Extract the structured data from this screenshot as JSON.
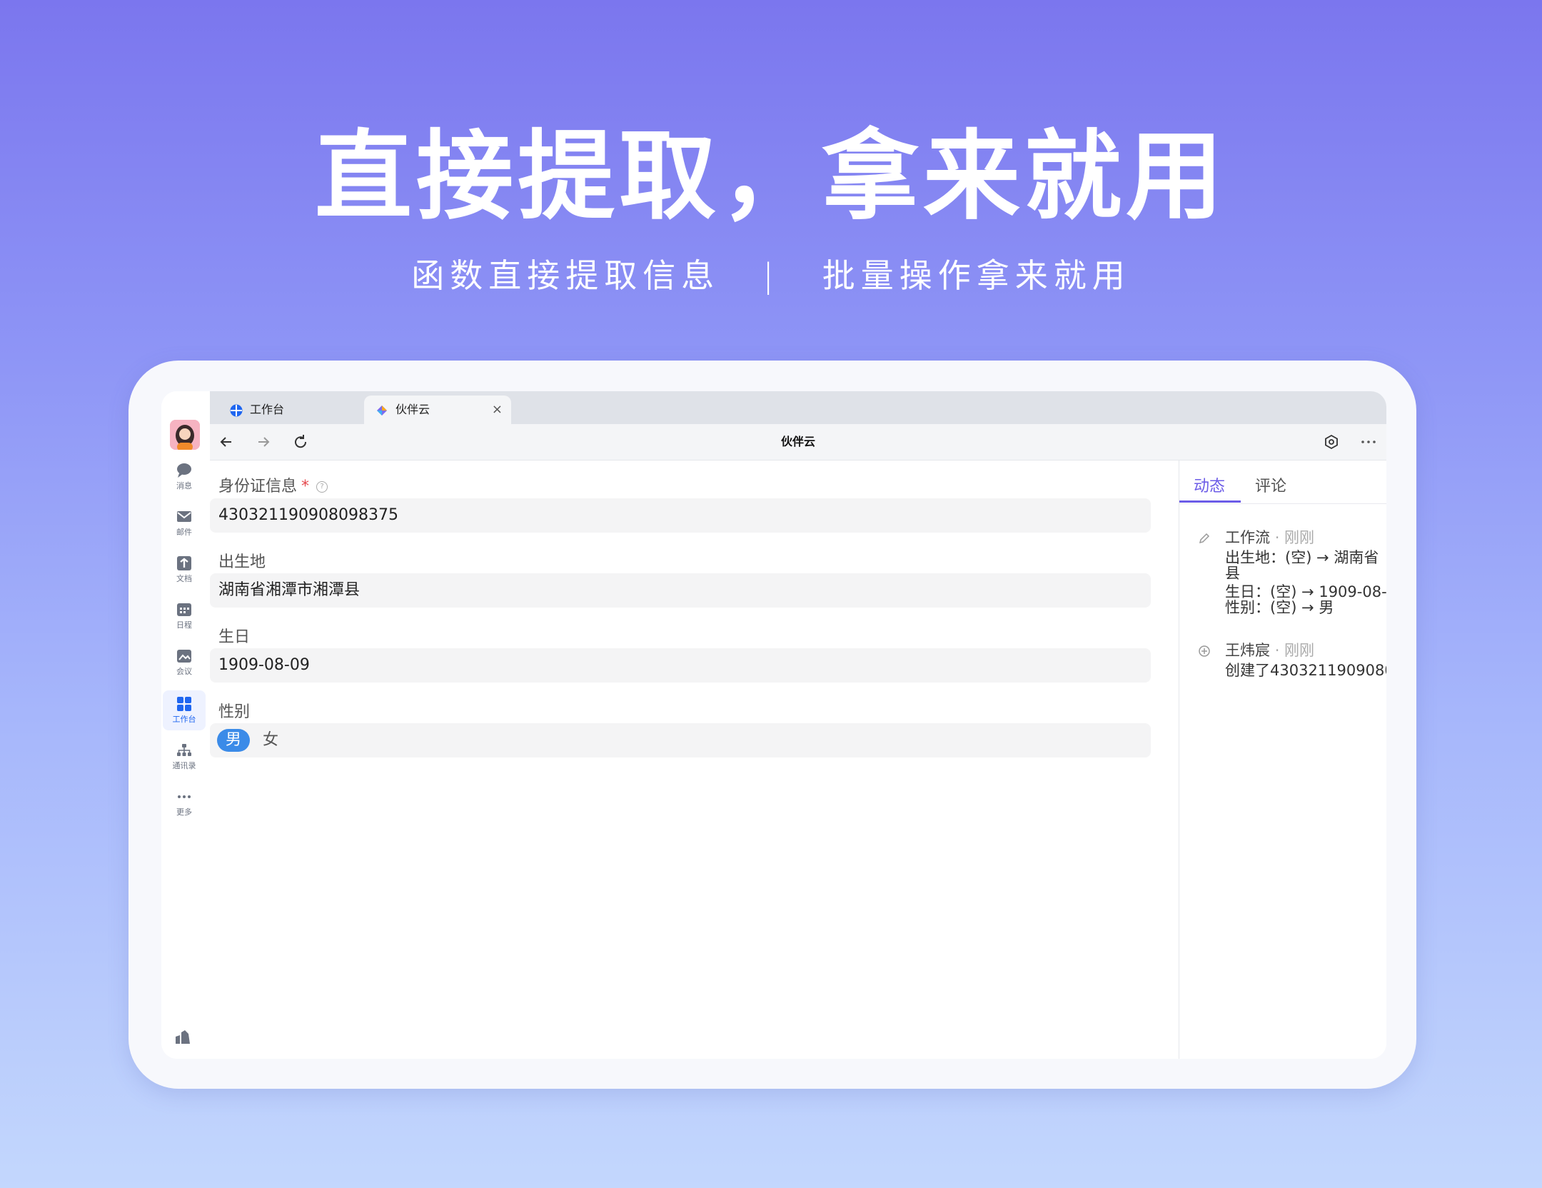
{
  "hero": {
    "title": "直接提取，拿来就用",
    "subtitle_left": "函数直接提取信息",
    "subtitle_sep": "|",
    "subtitle_right": "批量操作拿来就用"
  },
  "rail": {
    "items": [
      {
        "label": "消息",
        "icon": "chat-icon"
      },
      {
        "label": "邮件",
        "icon": "mail-icon"
      },
      {
        "label": "文档",
        "icon": "doc-icon"
      },
      {
        "label": "日程",
        "icon": "calendar-icon"
      },
      {
        "label": "会议",
        "icon": "meeting-icon"
      },
      {
        "label": "工作台",
        "icon": "workbench-icon",
        "active": true
      },
      {
        "label": "通讯录",
        "icon": "contacts-icon"
      },
      {
        "label": "更多",
        "icon": "more-icon"
      }
    ]
  },
  "browser": {
    "tabs": [
      {
        "label": "工作台",
        "icon": "workbench-tab-icon"
      },
      {
        "label": "伙伴云",
        "icon": "huoban-logo-icon",
        "active": true
      }
    ],
    "page_title": "伙伴云"
  },
  "form": {
    "fields": [
      {
        "label": "身份证信息",
        "required": true,
        "value": "430321190908098375"
      },
      {
        "label": "出生地",
        "value": "湖南省湘潭市湘潭县"
      },
      {
        "label": "生日",
        "value": "1909-08-09"
      },
      {
        "label": "性别",
        "options": [
          "男",
          "女"
        ],
        "selected": "男"
      }
    ]
  },
  "panel": {
    "tabs": [
      "动态",
      "评论"
    ],
    "active_tab": "动态",
    "activities": [
      {
        "actor": "工作流",
        "time": "· 刚刚",
        "lines": [
          "出生地：(空) → 湖南省",
          "县",
          "生日：(空) → 1909-08-0",
          "性别：(空) → 男"
        ]
      },
      {
        "actor": "王炜宸",
        "time": "· 刚刚",
        "lines": [
          "创建了4303211909080"
        ]
      }
    ]
  },
  "colors": {
    "accent": "#6c5ce7",
    "chip": "#3b8be8",
    "brand_blue": "#1f66f0"
  }
}
